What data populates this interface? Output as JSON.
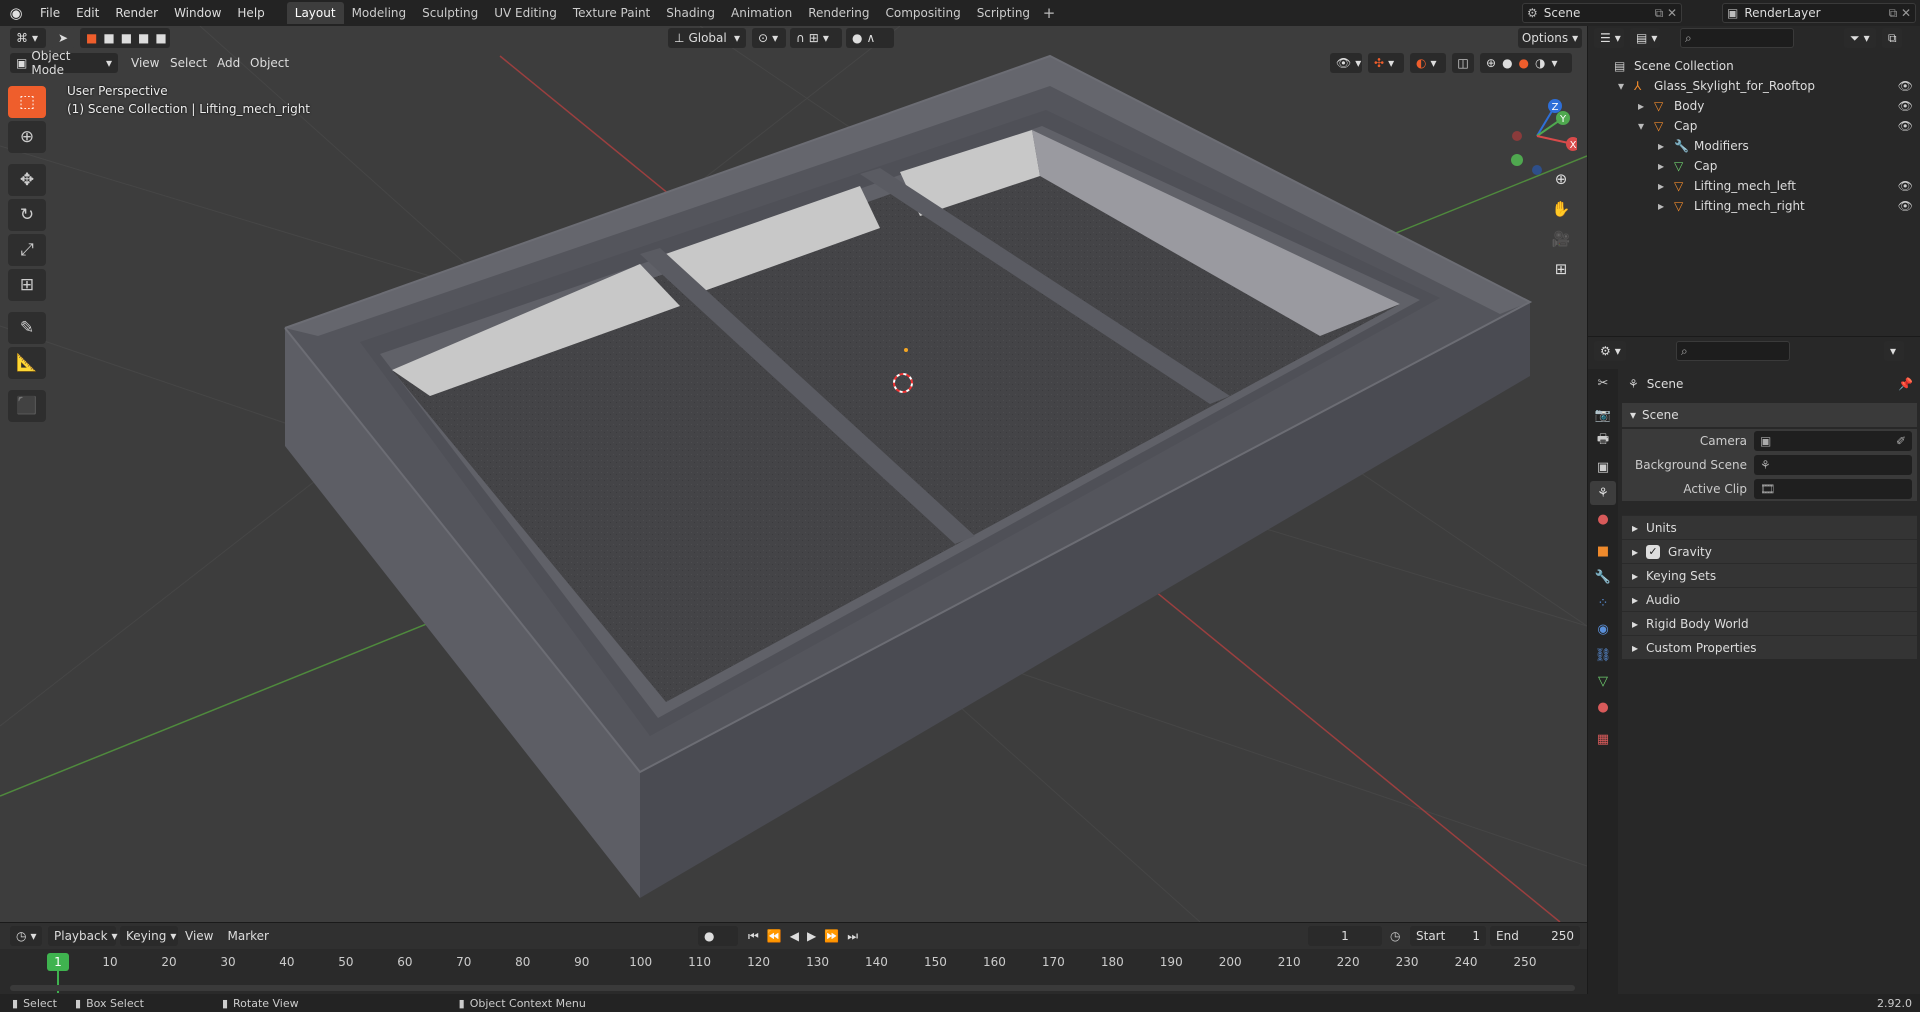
{
  "menus": [
    "File",
    "Edit",
    "Render",
    "Window",
    "Help"
  ],
  "workspace_tabs": [
    "Layout",
    "Modeling",
    "Sculpting",
    "UV Editing",
    "Texture Paint",
    "Shading",
    "Animation",
    "Rendering",
    "Compositing",
    "Scripting"
  ],
  "active_workspace": "Layout",
  "scene_name": "Scene",
  "render_layer": "RenderLayer",
  "viewport": {
    "mode": "Object Mode",
    "menus": [
      "View",
      "Select",
      "Add",
      "Object"
    ],
    "transform_orientation": "Global",
    "options_label": "Options",
    "info_line1": "User Perspective",
    "info_line2": "(1) Scene Collection | Lifting_mech_right",
    "gizmo": {
      "z": "Z",
      "y": "Y",
      "x": "X"
    }
  },
  "outliner": {
    "rows": [
      {
        "label": "Scene Collection",
        "indent": 0,
        "icon": "collection-icon",
        "eye": false,
        "selected": false
      },
      {
        "label": "Glass_Skylight_for_Rooftop",
        "indent": 1,
        "icon": "armature-icon",
        "eye": true,
        "selected": false
      },
      {
        "label": "Body",
        "indent": 2,
        "icon": "mesh-icon",
        "eye": true,
        "selected": false
      },
      {
        "label": "Cap",
        "indent": 2,
        "icon": "mesh-icon",
        "eye": true,
        "selected": false
      },
      {
        "label": "Modifiers",
        "indent": 3,
        "icon": "wrench-icon",
        "eye": false,
        "selected": false
      },
      {
        "label": "Cap",
        "indent": 3,
        "icon": "mesh-data-icon",
        "eye": false,
        "selected": false
      },
      {
        "label": "Lifting_mech_left",
        "indent": 3,
        "icon": "mesh-icon",
        "eye": true,
        "selected": false
      },
      {
        "label": "Lifting_mech_right",
        "indent": 3,
        "icon": "mesh-icon",
        "eye": true,
        "selected": false
      }
    ]
  },
  "properties": {
    "context": "Scene",
    "panel_title": "Scene",
    "fields": [
      {
        "label": "Camera",
        "value": ""
      },
      {
        "label": "Background Scene",
        "value": ""
      },
      {
        "label": "Active Clip",
        "value": ""
      }
    ],
    "subpanels": [
      "Units",
      "Gravity",
      "Keying Sets",
      "Audio",
      "Rigid Body World",
      "Custom Properties"
    ]
  },
  "timeline": {
    "menus": [
      "Playback",
      "Keying",
      "View",
      "Marker"
    ],
    "current_frame": "1",
    "start_label": "Start",
    "start": "1",
    "end_label": "End",
    "end": "250",
    "ticks": [
      "1",
      "10",
      "20",
      "30",
      "40",
      "50",
      "60",
      "70",
      "80",
      "90",
      "100",
      "110",
      "120",
      "130",
      "140",
      "150",
      "160",
      "170",
      "180",
      "190",
      "200",
      "210",
      "220",
      "230",
      "240",
      "250"
    ]
  },
  "statusbar": {
    "select": "Select",
    "box_select": "Box Select",
    "rotate_view": "Rotate View",
    "context_menu": "Object Context Menu",
    "version": "2.92.0"
  },
  "colors": {
    "accent": "#ef5e2c",
    "selected_row": "#334d80",
    "frame_green": "#3fb34f"
  }
}
